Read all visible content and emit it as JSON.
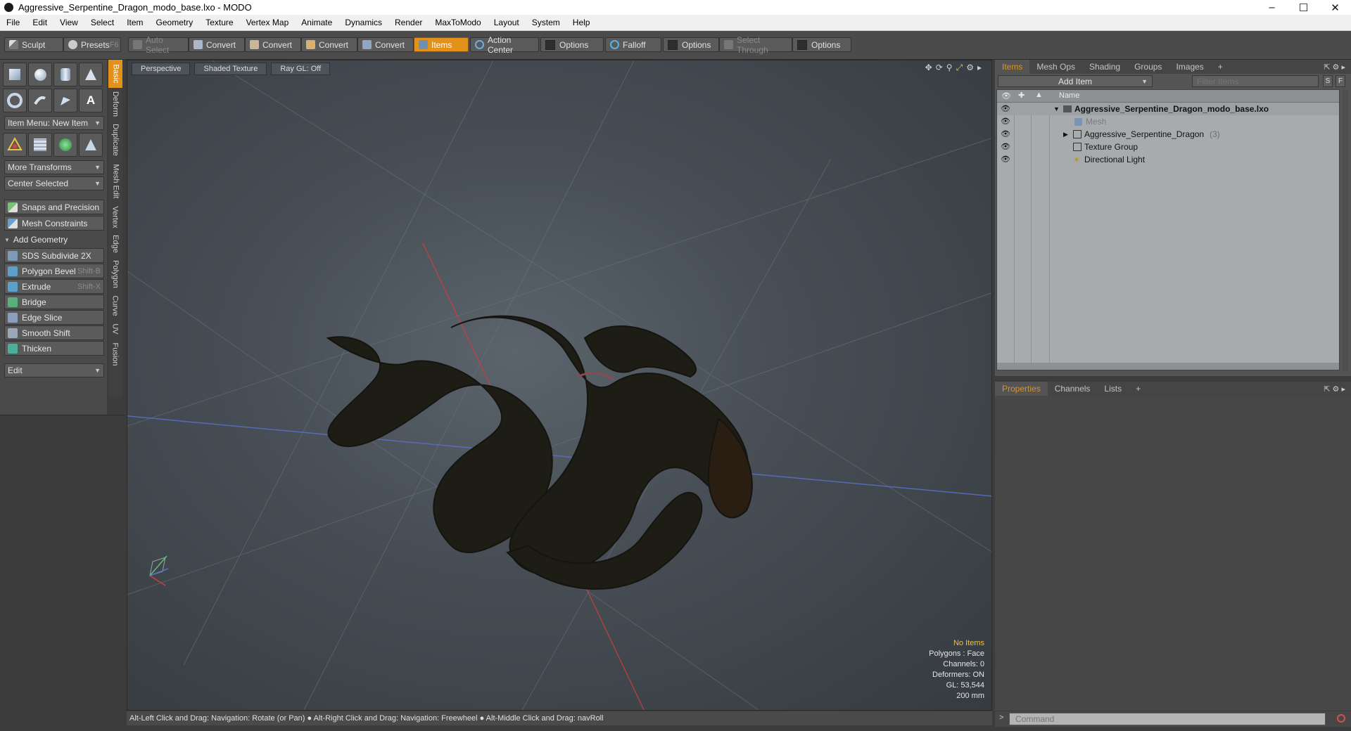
{
  "window": {
    "title": "Aggressive_Serpentine_Dragon_modo_base.lxo - MODO"
  },
  "menu": [
    "File",
    "Edit",
    "View",
    "Select",
    "Item",
    "Geometry",
    "Texture",
    "Vertex Map",
    "Animate",
    "Dynamics",
    "Render",
    "MaxToModo",
    "Layout",
    "System",
    "Help"
  ],
  "toolbar": {
    "sculpt": "Sculpt",
    "presets": "Presets",
    "presets_shortcut": "F6",
    "auto_select": "Auto Select",
    "convert1": "Convert",
    "convert2": "Convert",
    "convert3": "Convert",
    "convert4": "Convert",
    "items": "Items",
    "action_center": "Action Center",
    "options1": "Options",
    "falloff": "Falloff",
    "options2": "Options",
    "select_through": "Select Through",
    "options3": "Options"
  },
  "left": {
    "item_menu": "Item Menu: New Item",
    "more_transforms": "More Transforms",
    "center_selected": "Center Selected",
    "snaps": "Snaps and Precision",
    "constraints": "Mesh Constraints",
    "add_geometry": "Add Geometry",
    "tools": [
      {
        "label": "SDS Subdivide 2X",
        "shortcut": ""
      },
      {
        "label": "Polygon Bevel",
        "shortcut": "Shift-B"
      },
      {
        "label": "Extrude",
        "shortcut": "Shift-X"
      },
      {
        "label": "Bridge",
        "shortcut": ""
      },
      {
        "label": "Edge Slice",
        "shortcut": ""
      },
      {
        "label": "Smooth Shift",
        "shortcut": ""
      },
      {
        "label": "Thicken",
        "shortcut": ""
      }
    ],
    "edit": "Edit",
    "vtabs": [
      "Basic",
      "Deform",
      "Duplicate",
      "Mesh Edit",
      "Vertex",
      "Edge",
      "Polygon",
      "Curve",
      "UV",
      "Fusion"
    ]
  },
  "viewport": {
    "tabs": [
      "Perspective",
      "Shaded Texture",
      "Ray GL: Off"
    ],
    "hud": {
      "items": "No Items",
      "polygons": "Polygons : Face",
      "channels": "Channels: 0",
      "deformers": "Deformers: ON",
      "gl": "GL: 53,544",
      "scale": "200 mm"
    }
  },
  "status": "Alt-Left Click and Drag: Navigation: Rotate (or Pan) ●  Alt-Right Click and Drag: Navigation: Freewheel ●  Alt-Middle Click and Drag: navRoll",
  "items_panel": {
    "tabs": [
      "Items",
      "Mesh Ops",
      "Shading",
      "Groups",
      "Images",
      "+"
    ],
    "add_item": "Add Item",
    "filter_placeholder": "Filter Items",
    "s_btn": "S",
    "f_btn": "F",
    "name_col": "Name",
    "tree": [
      {
        "label": "Aggressive_Serpentine_Dragon_modo_base.lxo",
        "suffix": ""
      },
      {
        "label": "Mesh",
        "suffix": ""
      },
      {
        "label": "Aggressive_Serpentine_Dragon",
        "suffix": "(3)"
      },
      {
        "label": "Texture Group",
        "suffix": ""
      },
      {
        "label": "Directional Light",
        "suffix": ""
      }
    ]
  },
  "props_panel": {
    "tabs": [
      "Properties",
      "Channels",
      "Lists",
      "+"
    ]
  },
  "command": {
    "placeholder": "Command"
  },
  "colors": {
    "accent": "#e2921a",
    "viewport_bg": "#474e55"
  }
}
